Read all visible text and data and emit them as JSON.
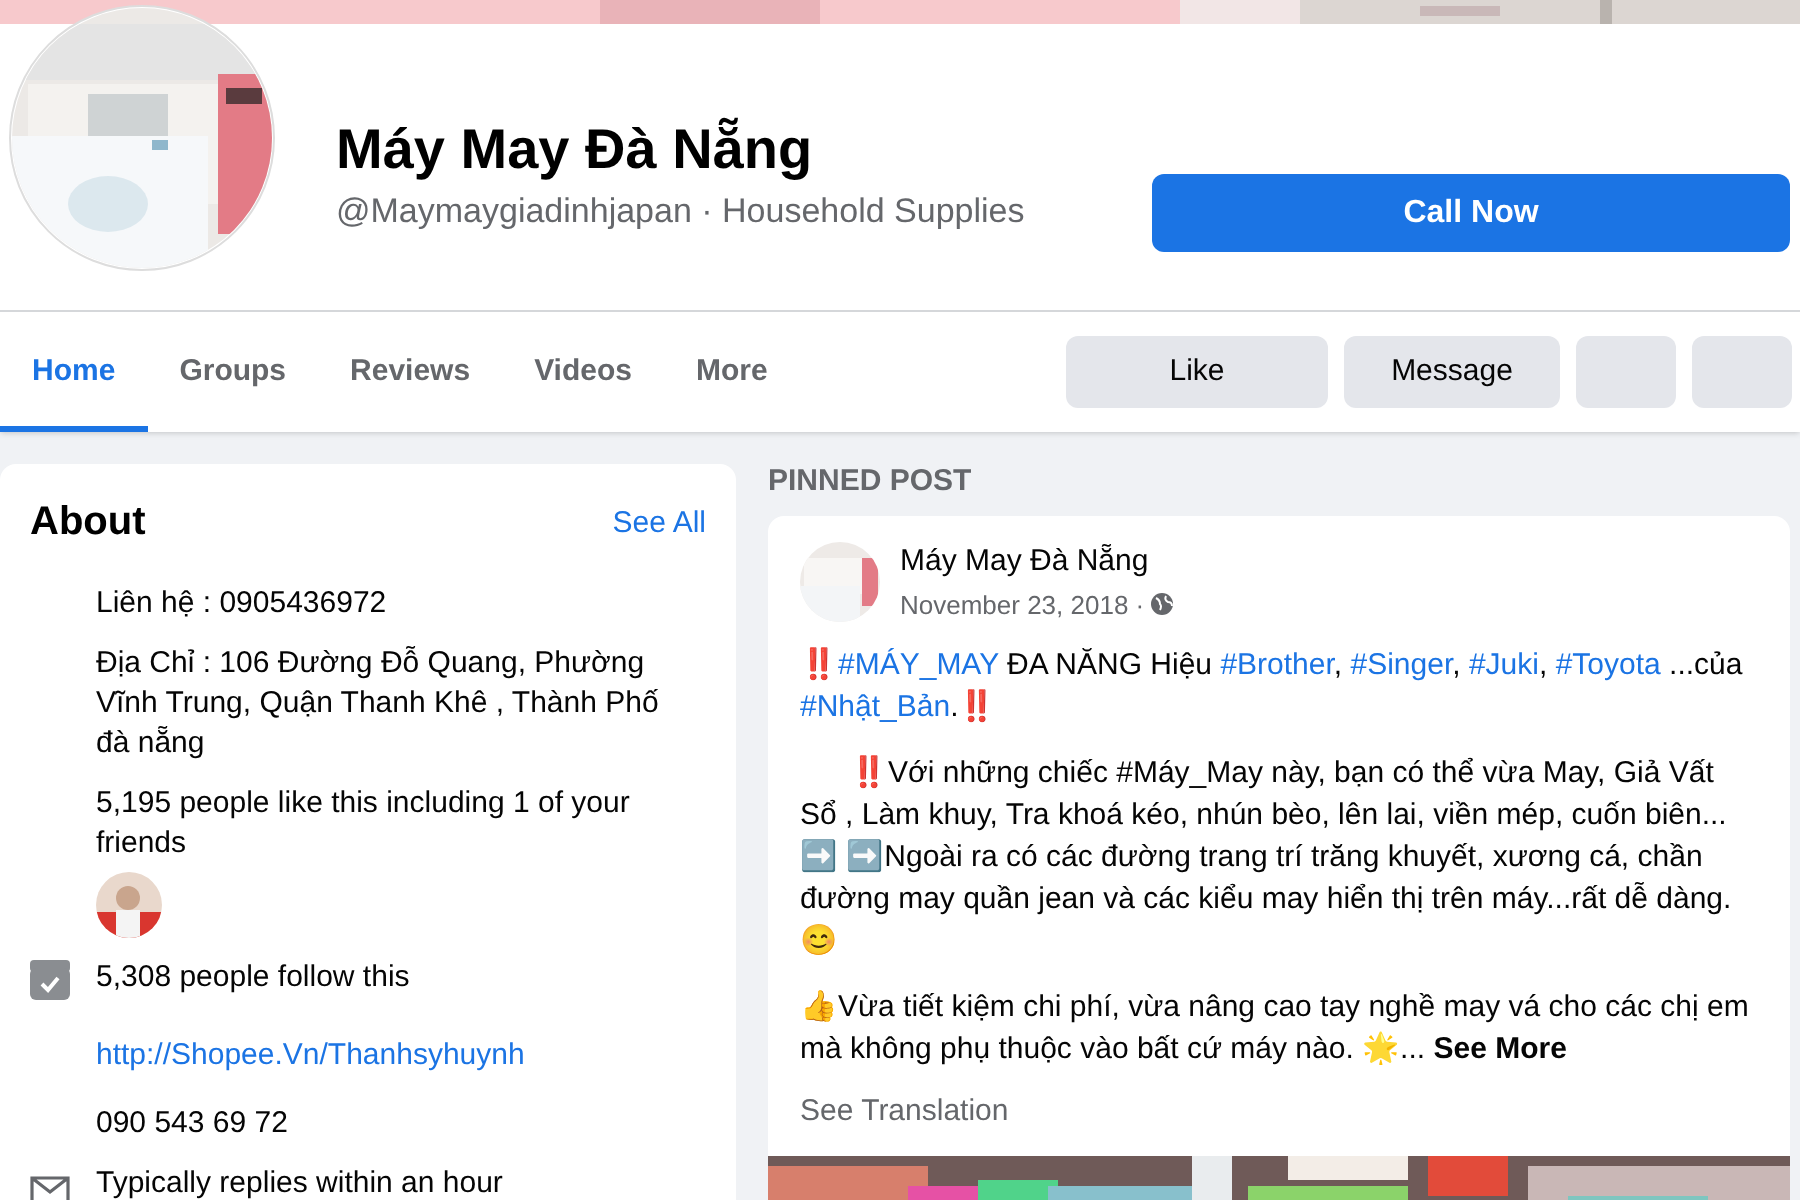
{
  "page": {
    "name": "Máy May Đà Nẵng",
    "subtitle": "@Maymaygiadinhjapan · Household Supplies",
    "primary_button": "Call Now"
  },
  "tabs": [
    {
      "label": "Home",
      "selected": true
    },
    {
      "label": "Groups",
      "selected": false
    },
    {
      "label": "Reviews",
      "selected": false
    },
    {
      "label": "Videos",
      "selected": false
    },
    {
      "label": "More",
      "selected": false
    }
  ],
  "actions": [
    {
      "kind": "text",
      "label": "Like"
    },
    {
      "kind": "text",
      "label": "Message"
    },
    {
      "kind": "blank"
    },
    {
      "kind": "blank"
    }
  ],
  "about": {
    "title": "About",
    "link": "See All",
    "items": [
      {
        "kind": "text",
        "text": "Liên hệ : 0905436972"
      },
      {
        "kind": "text",
        "text": "Địa Chỉ : 106 Đường Đỗ Quang, Phường Vĩnh Trung, Quận Thanh Khê , Thành Phố đà nẵng"
      },
      {
        "kind": "likes",
        "text": "5,195 people like this including 1 of your friends"
      },
      {
        "kind": "follow",
        "text": "5,308 people follow this"
      },
      {
        "kind": "link",
        "text": "http://Shopee.Vn/Thanhsyhuynh"
      },
      {
        "kind": "text",
        "text": "090 543 69 72"
      },
      {
        "kind": "mail",
        "text": "Typically replies within an hour"
      }
    ]
  },
  "pinned": {
    "label": "PINNED POST",
    "author": "Máy May Đà Nẵng",
    "date": "November 23, 2018 ·",
    "paragraphs": [
      [
        {
          "kind": "text",
          "text": "‼️"
        },
        {
          "kind": "tag",
          "text": "#MÁY_MAY"
        },
        {
          "kind": "text",
          "text": " ĐA NĂNG Hiệu "
        },
        {
          "kind": "tag",
          "text": "#Brother"
        },
        {
          "kind": "text",
          "text": ", "
        },
        {
          "kind": "tag",
          "text": "#Singer"
        },
        {
          "kind": "text",
          "text": ", "
        },
        {
          "kind": "tag",
          "text": "#Juki"
        },
        {
          "kind": "text",
          "text": ", "
        },
        {
          "kind": "tag",
          "text": "#Toyota"
        },
        {
          "kind": "text",
          "text": " ...của "
        },
        {
          "kind": "tag",
          "text": "#Nhật_Bản"
        },
        {
          "kind": "text",
          "text": ".‼️"
        }
      ],
      [
        {
          "kind": "text",
          "text": "      ‼️Với những chiếc #Máy_May này, bạn có thể vừa May, Giả Vất Sổ , Làm khuy, Tra khoá kéo, nhún bèo, lên lai, viền mép, cuốn biên... ➡️ ➡️Ngoài ra có các đường trang trí trăng khuyết, xương cá, chần đường may quần jean và các kiểu may hiển thị trên máy...rất dễ dàng. 😊"
        }
      ],
      [
        {
          "kind": "text",
          "text": "👍Vừa tiết kiệm chi phí, vừa nâng cao tay nghề may vá cho các chị em mà không phụ thuộc vào bất cứ máy nào. 🌟... "
        },
        {
          "kind": "more",
          "text": "See More"
        }
      ]
    ],
    "translation": "See Translation"
  }
}
